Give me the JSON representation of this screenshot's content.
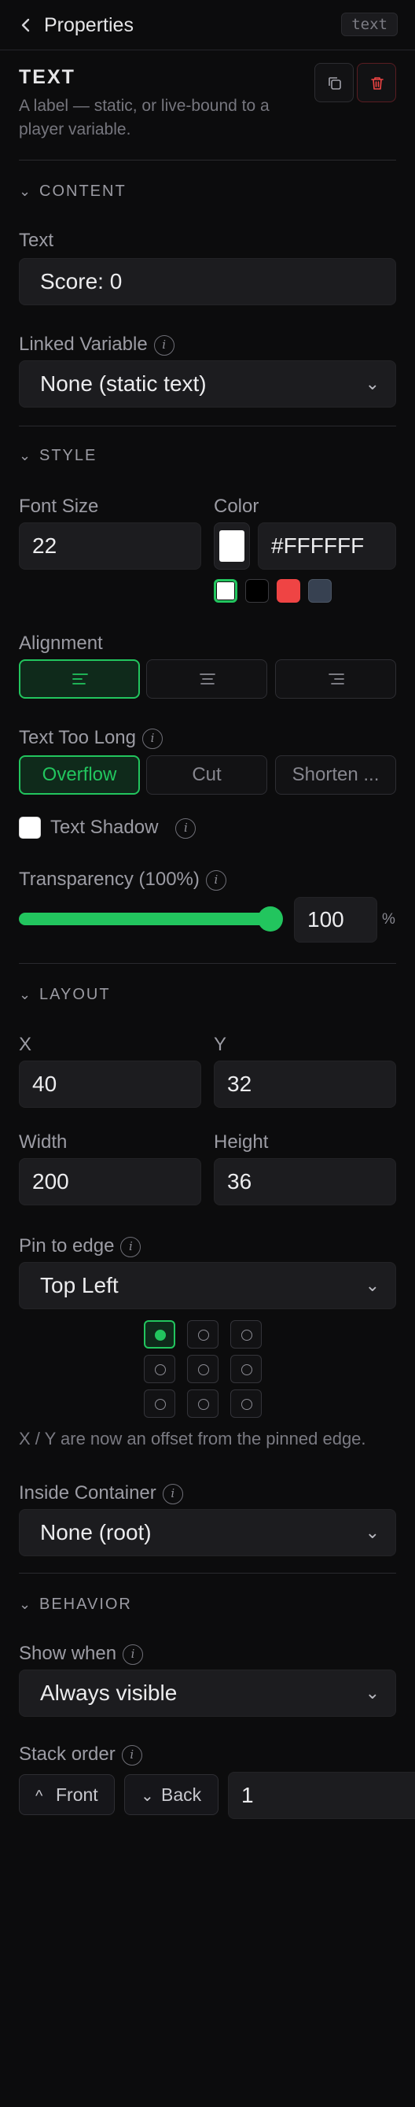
{
  "topbar": {
    "back_icon": "chevron-left-icon",
    "title": "Properties",
    "tag": "text"
  },
  "header": {
    "title": "TEXT",
    "description": "A label — static, or live-bound to a player variable.",
    "duplicate_icon": "copy-icon",
    "delete_icon": "trash-icon"
  },
  "content": {
    "section": "CONTENT",
    "text_label": "Text",
    "text_value": "Score: 0",
    "linked_label": "Linked Variable",
    "linked_value": "None (static text)"
  },
  "style": {
    "section": "STYLE",
    "font_size_label": "Font Size",
    "font_size_value": "22",
    "color_label": "Color",
    "color_value": "#FFFFFF",
    "swatches": [
      "#FFFFFF",
      "#000000",
      "#EF4444",
      "#374151"
    ],
    "alignment_label": "Alignment",
    "alignment_selected": "left",
    "overflow_label": "Text Too Long",
    "overflow_options": [
      "Overflow",
      "Cut",
      "Shorten ..."
    ],
    "overflow_selected": "Overflow",
    "shadow_label": "Text Shadow",
    "transparency_label": "Transparency (100%)",
    "transparency_value": "100",
    "transparency_unit": "%",
    "transparency_fraction": 1.0
  },
  "layout": {
    "section": "LAYOUT",
    "x_label": "X",
    "x_value": "40",
    "y_label": "Y",
    "y_value": "32",
    "width_label": "Width",
    "width_value": "200",
    "height_label": "Height",
    "height_value": "36",
    "pin_label": "Pin to edge",
    "pin_value": "Top Left",
    "pin_hint": "X / Y are now an offset from the pinned edge.",
    "container_label": "Inside Container",
    "container_value": "None (root)"
  },
  "behavior": {
    "section": "BEHAVIOR",
    "show_label": "Show when",
    "show_value": "Always visible",
    "stack_label": "Stack order",
    "front_label": "Front",
    "back_label": "Back",
    "stack_value": "1"
  },
  "colors": {
    "accent": "#22C55E",
    "danger": "#EF4444",
    "panel": "#1C1C1F"
  }
}
